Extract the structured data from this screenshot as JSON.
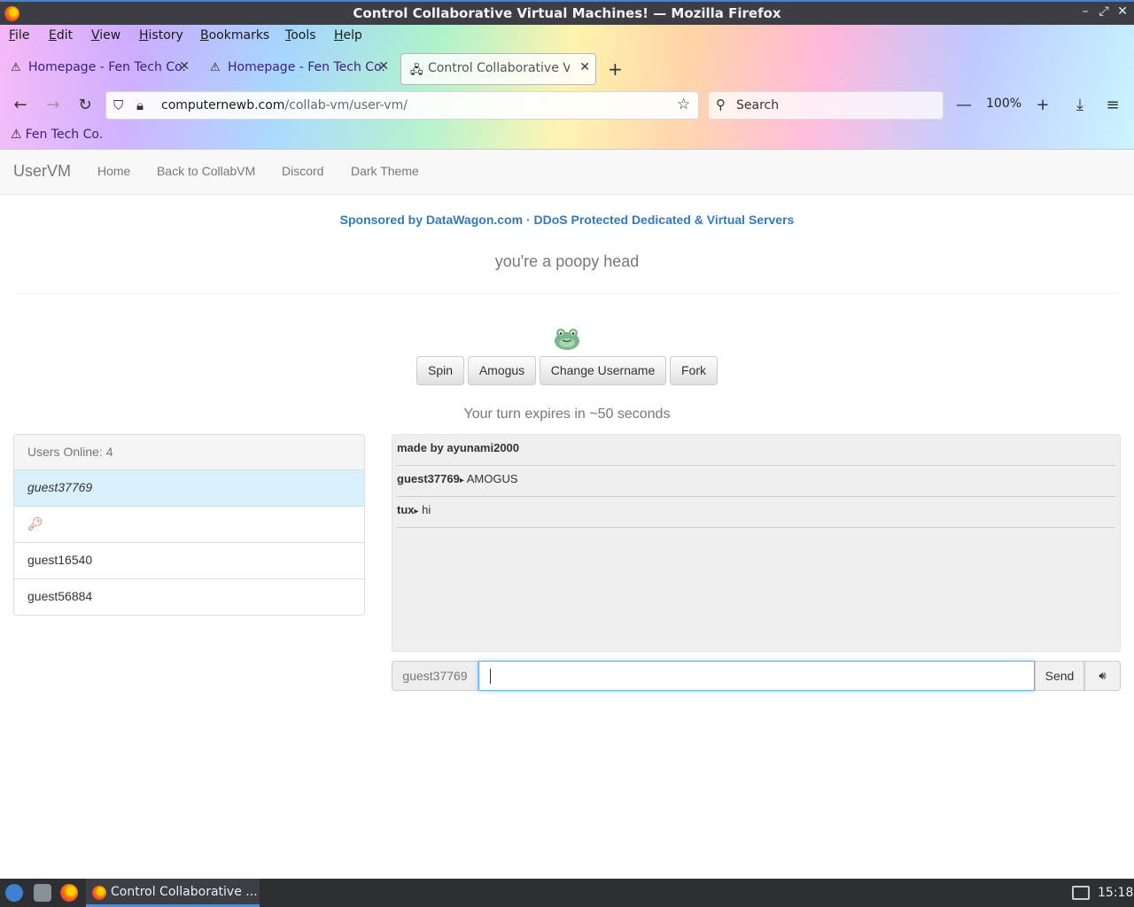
{
  "window": {
    "title": "Control Collaborative Virtual Machines! — Mozilla Firefox"
  },
  "menubar": [
    "File",
    "Edit",
    "View",
    "History",
    "Bookmarks",
    "Tools",
    "Help"
  ],
  "tabs": [
    {
      "label": "Homepage - Fen Tech Co.",
      "active": false
    },
    {
      "label": "Homepage - Fen Tech Co.",
      "active": false
    },
    {
      "label": "Control Collaborative Virt",
      "active": true
    }
  ],
  "urlbar": {
    "domain": "computernewb.com",
    "path": "/collab-vm/user-vm/"
  },
  "search": {
    "placeholder": "Search"
  },
  "zoom": "100%",
  "bookmarks": [
    "Fen Tech Co."
  ],
  "site": {
    "brand": "UserVM",
    "nav": [
      "Home",
      "Back to CollabVM",
      "Discord",
      "Dark Theme"
    ],
    "sponsor": "Sponsored by DataWagon.com · DDoS Protected Dedicated & Virtual Servers",
    "motd": "you're a poopy head",
    "buttons": [
      "Spin",
      "Amogus",
      "Change Username",
      "Fork"
    ],
    "turn_text": "Your turn expires in ~50 seconds",
    "users_header": "Users Online: 4",
    "users": [
      "guest37769",
      "",
      "guest16540",
      "guest56884"
    ],
    "chat": [
      {
        "user": "made by ayunami2000",
        "text": ""
      },
      {
        "user": "guest37769",
        "text": "AMOGUS"
      },
      {
        "user": "tux",
        "text": "hi"
      }
    ],
    "chat_username": "guest37769",
    "chat_input_value": "",
    "send_label": "Send"
  },
  "taskbar": {
    "task_label": "Control Collaborative ...",
    "clock": "15:18"
  },
  "colors": {
    "link": "#337ab7",
    "accent": "#4a90d9",
    "selected_user": "#d9f1fb"
  }
}
